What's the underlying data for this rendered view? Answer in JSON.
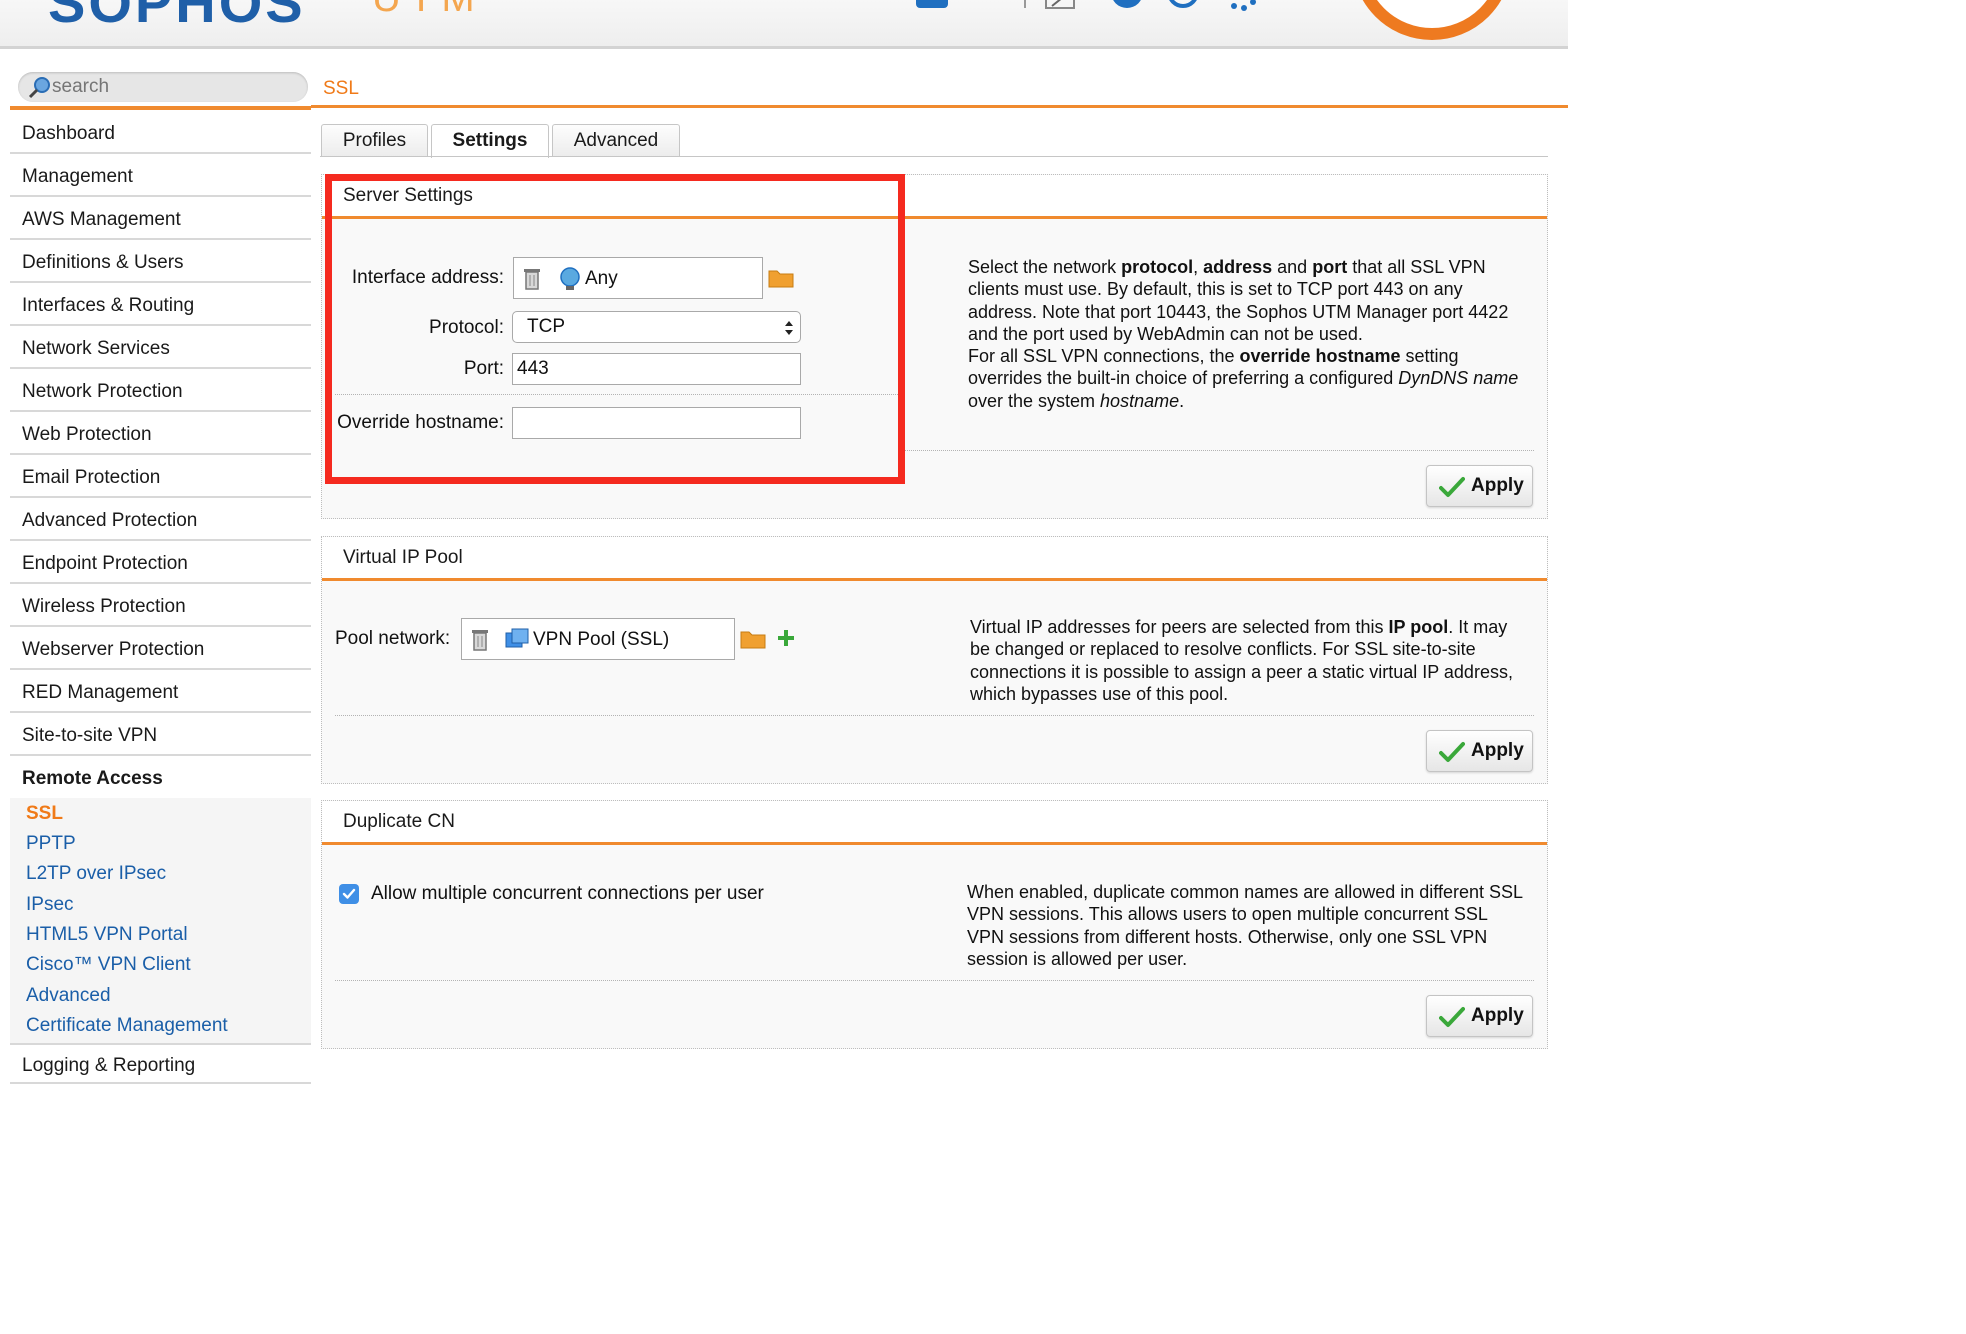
{
  "header": {
    "logo_text": "SOPHOS",
    "product_text": "UTM"
  },
  "search": {
    "placeholder": "search"
  },
  "sidebar": {
    "items": [
      {
        "label": "Dashboard"
      },
      {
        "label": "Management"
      },
      {
        "label": "AWS Management"
      },
      {
        "label": "Definitions & Users"
      },
      {
        "label": "Interfaces & Routing"
      },
      {
        "label": "Network Services"
      },
      {
        "label": "Network Protection"
      },
      {
        "label": "Web Protection"
      },
      {
        "label": "Email Protection"
      },
      {
        "label": "Advanced Protection"
      },
      {
        "label": "Endpoint Protection"
      },
      {
        "label": "Wireless Protection"
      },
      {
        "label": "Webserver Protection"
      },
      {
        "label": "RED Management"
      },
      {
        "label": "Site-to-site VPN"
      }
    ],
    "remote_access": {
      "label": "Remote Access",
      "sub_items": [
        {
          "label": "SSL",
          "active": true
        },
        {
          "label": "PPTP"
        },
        {
          "label": "L2TP over IPsec"
        },
        {
          "label": "IPsec"
        },
        {
          "label": "HTML5 VPN Portal"
        },
        {
          "label": "Cisco™ VPN Client"
        },
        {
          "label": "Advanced"
        },
        {
          "label": "Certificate Management"
        }
      ]
    },
    "next_item": {
      "label": "Logging & Reporting"
    }
  },
  "page": {
    "title": "SSL"
  },
  "tabs": [
    {
      "label": "Profiles"
    },
    {
      "label": "Settings",
      "active": true
    },
    {
      "label": "Advanced"
    }
  ],
  "server_settings": {
    "title": "Server Settings",
    "interface_address": {
      "label": "Interface address:",
      "value": "Any"
    },
    "protocol": {
      "label": "Protocol:",
      "value": "TCP"
    },
    "port": {
      "label": "Port:",
      "value": "443"
    },
    "override_hostname": {
      "label": "Override hostname:",
      "value": ""
    },
    "help": {
      "line1_a": "Select the network ",
      "line1_b": "protocol",
      "line1_c": ", ",
      "line1_d": "address",
      "line1_e": " and ",
      "line1_f": "port",
      "line1_g": " that all SSL VPN clients must use. By default, this is set to TCP port 443 on any address. Note that port 10443, the Sophos UTM Manager port 4422 and the port used by WebAdmin can not be used.",
      "line2_a": "For all SSL VPN connections, the ",
      "line2_b": "override hostname",
      "line2_c": " setting overrides the built-in choice of preferring a configured ",
      "line2_d": "DynDNS name",
      "line2_e": " over the system ",
      "line2_f": "hostname",
      "line2_g": "."
    },
    "apply_label": "Apply"
  },
  "virtual_ip_pool": {
    "title": "Virtual IP Pool",
    "pool_network": {
      "label": "Pool network:",
      "value": "VPN Pool (SSL)"
    },
    "help": {
      "a": "Virtual IP addresses for peers are selected from this ",
      "b": "IP pool",
      "c": ". It may be changed or replaced to resolve conflicts. For SSL site-to-site connections it is possible to assign a peer a static virtual IP address, which bypasses use of this pool."
    },
    "apply_label": "Apply"
  },
  "duplicate_cn": {
    "title": "Duplicate CN",
    "checkbox_label": "Allow multiple concurrent connections per user",
    "checked": true,
    "help": "When enabled, duplicate common names are allowed in different SSL VPN sessions. This allows users to open multiple concurrent SSL VPN sessions from different hosts. Otherwise, only one SSL VPN session is allowed per user.",
    "apply_label": "Apply"
  },
  "colors": {
    "accent_orange": "#f08a2e",
    "link_blue": "#1a5ea8",
    "highlight_red": "#f52a1f",
    "checkbox_blue": "#3f8fe6"
  },
  "icons": {
    "search": "magnifier-icon",
    "trash": "trash-icon",
    "folder": "folder-icon",
    "add": "plus-icon",
    "apply": "checkmark-icon",
    "network": "globe-network-icon",
    "pool": "network-pool-icon"
  }
}
